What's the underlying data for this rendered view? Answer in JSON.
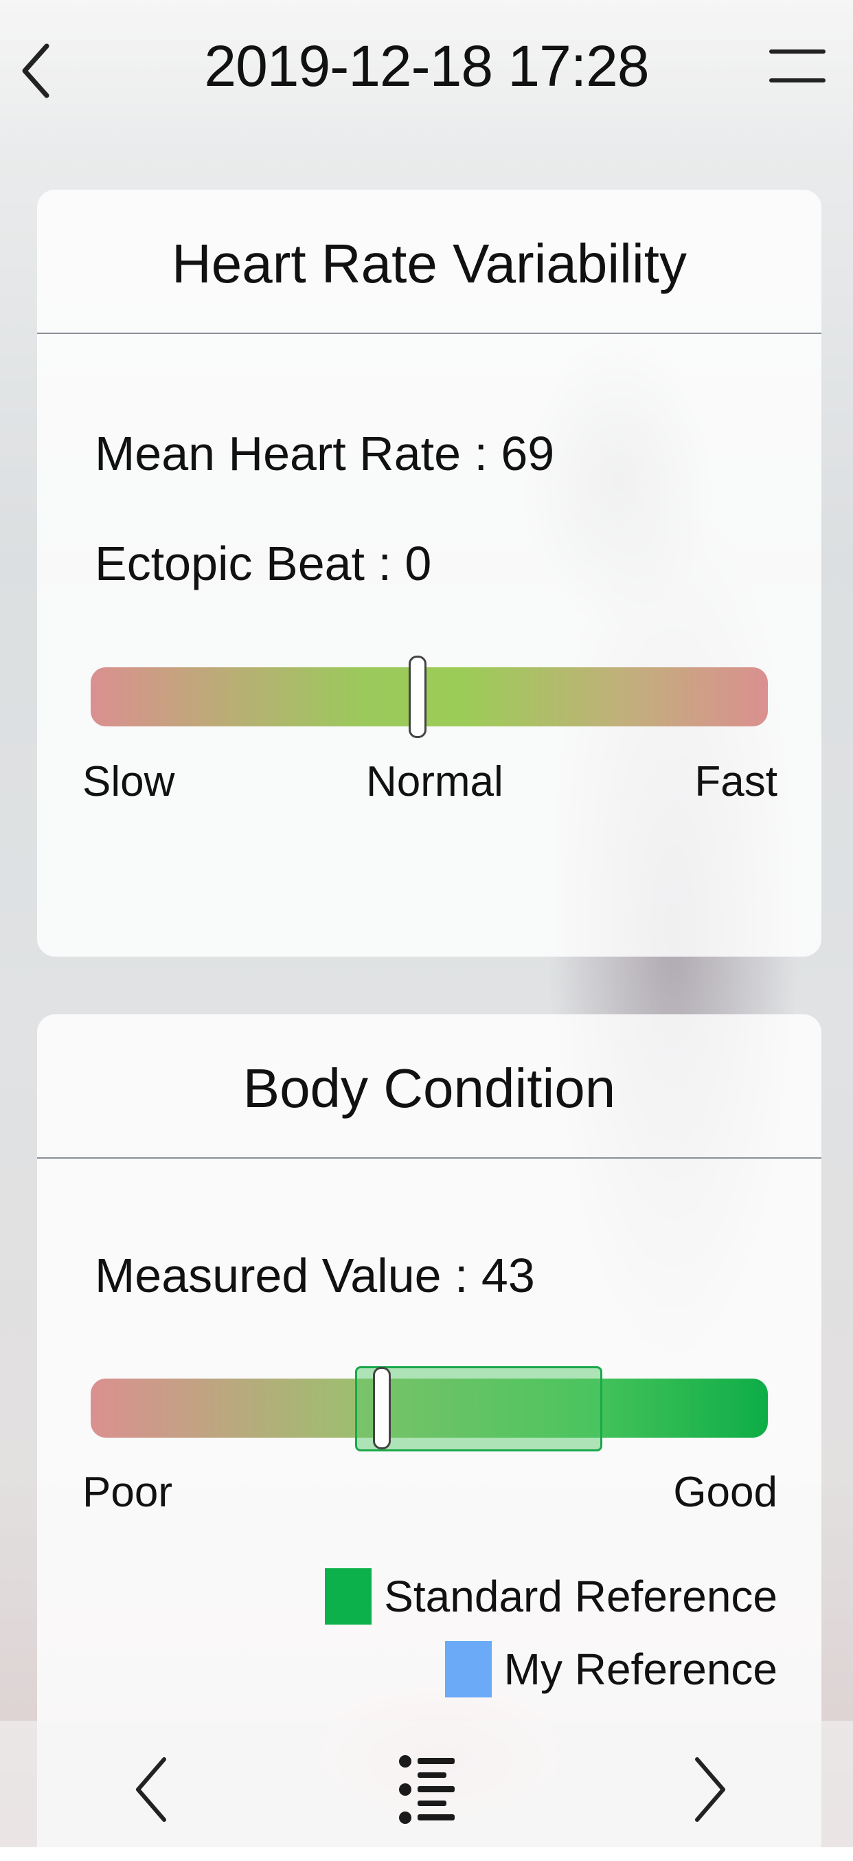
{
  "header": {
    "title": "2019-12-18 17:28",
    "back_icon": "chevron-left-icon",
    "menu_icon": "menu-icon"
  },
  "hrv_card": {
    "title": "Heart Rate Variability",
    "mean_heart_rate": "Mean Heart Rate : 69",
    "ectopic_beat": "Ectopic Beat : 0",
    "scale": {
      "low": "Slow",
      "mid": "Normal",
      "high": "Fast",
      "indicator_fraction": 0.483
    }
  },
  "body_card": {
    "title": "Body Condition",
    "measured_value": "Measured Value : 43",
    "scale": {
      "low": "Poor",
      "high": "Good",
      "indicator_fraction": 0.43,
      "standard_reference_range": [
        0.39,
        0.75
      ]
    },
    "legend": [
      {
        "label": "Standard Reference",
        "color": "#0db14b"
      },
      {
        "label": "My Reference",
        "color": "#6aaaf7"
      }
    ]
  },
  "bottom_nav": {
    "prev_icon": "chevron-left-icon",
    "list_icon": "list-icon",
    "next_icon": "chevron-right-icon"
  },
  "colors": {
    "accent_green": "#0db14b",
    "slow_red": "#da9090",
    "normal_green": "#9ccc57"
  }
}
